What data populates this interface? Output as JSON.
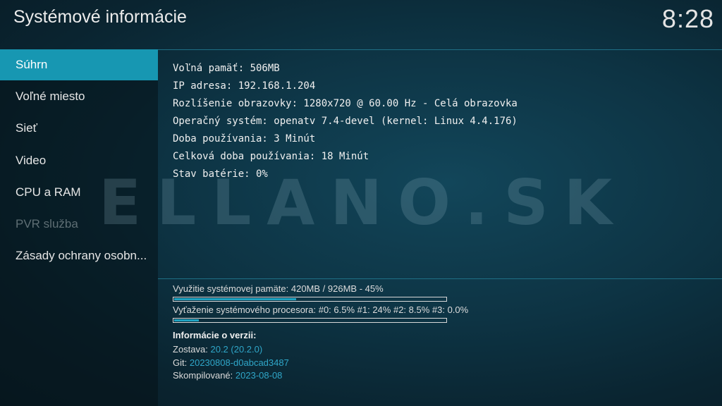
{
  "header": {
    "title": "Systémové informácie",
    "clock": "8:28"
  },
  "sidebar": {
    "items": [
      {
        "label": "Súhrn"
      },
      {
        "label": "Voľné miesto"
      },
      {
        "label": "Sieť"
      },
      {
        "label": "Video"
      },
      {
        "label": "CPU a RAM"
      },
      {
        "label": "PVR služba"
      },
      {
        "label": "Zásady ochrany osobn..."
      }
    ],
    "active_index": 0
  },
  "summary": {
    "lines": [
      "Voľná pamäť: 506MB",
      "IP adresa: 192.168.1.204",
      "Rozlíšenie obrazovky: 1280x720 @ 60.00 Hz - Celá obrazovka",
      "Operačný systém: openatv 7.4-devel (kernel: Linux 4.4.176)",
      "Doba používania: 3 Minút",
      "Celková doba používania: 18 Minút",
      "Stav batérie: 0%"
    ]
  },
  "watermark": {
    "text": "ELLANO.SK"
  },
  "stats": {
    "memory_label": "Využitie systémovej pamäte: 420MB / 926MB - 45%",
    "memory_fraction": 0.45,
    "cpu_label": "Vyťaženie systémového procesora: #0: 6.5% #1:  24% #2: 8.5% #3: 0.0%",
    "cpu_fraction": 0.09
  },
  "version": {
    "heading": "Informácie o verzii:",
    "build_label": "Zostava:",
    "build_value": "20.2 (20.2.0)",
    "git_label": "Git:",
    "git_value": "20230808-d0abcad3487",
    "compiled_label": "Skompilované:",
    "compiled_value": "2023-08-08"
  },
  "colors": {
    "accent": "#1797b2",
    "value_blue": "#2fa6c8"
  }
}
